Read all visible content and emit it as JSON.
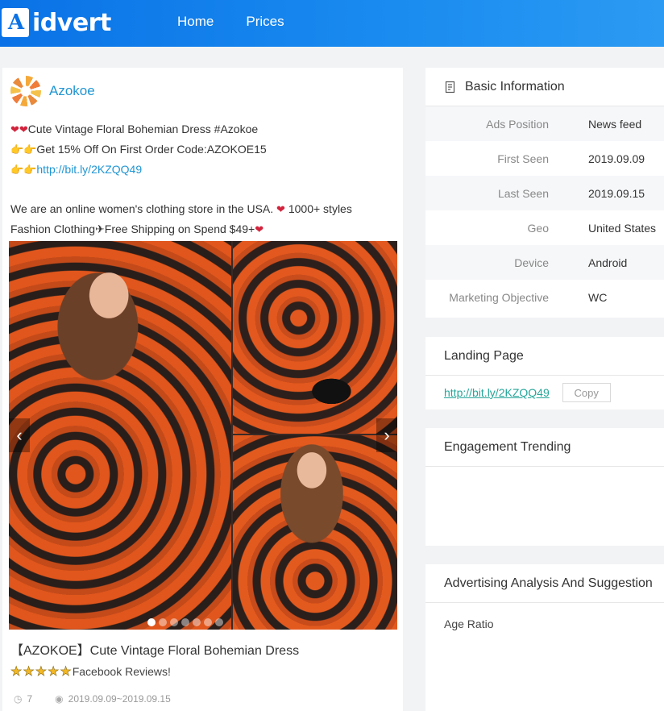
{
  "header": {
    "logo_mark": "A",
    "logo_text": "idvert",
    "nav": [
      "Home",
      "Prices"
    ]
  },
  "ad": {
    "brand": "Azokoe",
    "text_lines": [
      {
        "icon": "❤❤",
        "text": "Cute Vintage Floral Bohemian Dress #Azokoe"
      },
      {
        "icon": "👉👉",
        "text": "Get 15% Off On First Order Code:AZOKOE15"
      },
      {
        "icon": "👉👉",
        "link": "http://bit.ly/2KZQQ49"
      }
    ],
    "text_para_1": "We are an online women's clothing store in the USA.",
    "text_para_1_tail": " 1000+ styles",
    "text_para_2": "Fashion Clothing✈Free Shipping on Spend $49+",
    "title": "【AZOKOE】Cute Vintage Floral Bohemian Dress",
    "stars": 5,
    "rating_text": "Facebook Reviews!",
    "likes": "7",
    "date_range": "2019.09.09~2019.09.15",
    "carousel": {
      "total": 7,
      "active": 0
    }
  },
  "basic_info": {
    "title": "Basic Information",
    "rows": [
      {
        "k": "Ads Position",
        "v": "News feed"
      },
      {
        "k": "First Seen",
        "v": "2019.09.09"
      },
      {
        "k": "Last Seen",
        "v": "2019.09.15"
      },
      {
        "k": "Geo",
        "v": "United States"
      },
      {
        "k": "Device",
        "v": "Android"
      },
      {
        "k": "Marketing Objective",
        "v": "WC"
      }
    ]
  },
  "landing_page": {
    "title": "Landing Page",
    "url": "http://bit.ly/2KZQQ49",
    "copy_label": "Copy"
  },
  "engagement": {
    "title": "Engagement Trending"
  },
  "analysis": {
    "title": "Advertising Analysis And Suggestion",
    "age_ratio_label": "Age Ratio"
  }
}
